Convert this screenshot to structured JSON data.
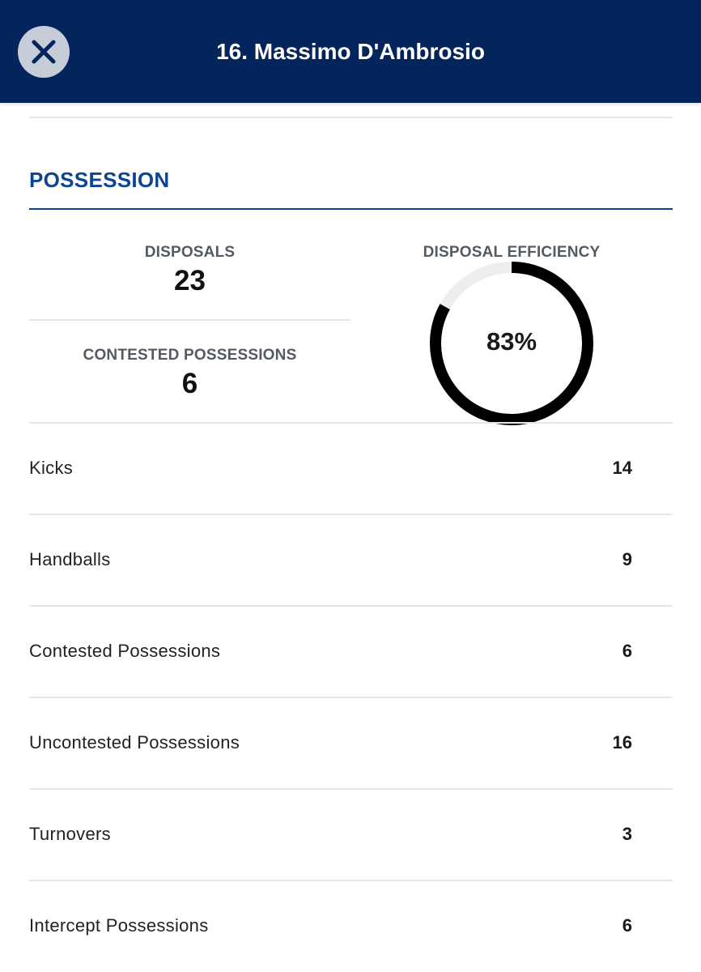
{
  "header": {
    "title": "16. Massimo D'Ambrosio",
    "close_icon": "close-icon"
  },
  "section": {
    "title": "POSSESSION"
  },
  "summary": {
    "disposals_label": "DISPOSALS",
    "disposals_value": "23",
    "contested_label": "CONTESTED POSSESSIONS",
    "contested_value": "6",
    "efficiency_label": "DISPOSAL EFFICIENCY",
    "efficiency_value": "83%",
    "efficiency_fraction": 0.83
  },
  "rows": [
    {
      "label": "Kicks",
      "value": "14"
    },
    {
      "label": "Handballs",
      "value": "9"
    },
    {
      "label": "Contested Possessions",
      "value": "6"
    },
    {
      "label": "Uncontested Possessions",
      "value": "16"
    },
    {
      "label": "Turnovers",
      "value": "3"
    },
    {
      "label": "Intercept Possessions",
      "value": "6"
    }
  ],
  "colors": {
    "header_bg": "#03255c",
    "accent": "#0d4592",
    "donut_fill": "#000000",
    "donut_track": "#eeeeee"
  }
}
